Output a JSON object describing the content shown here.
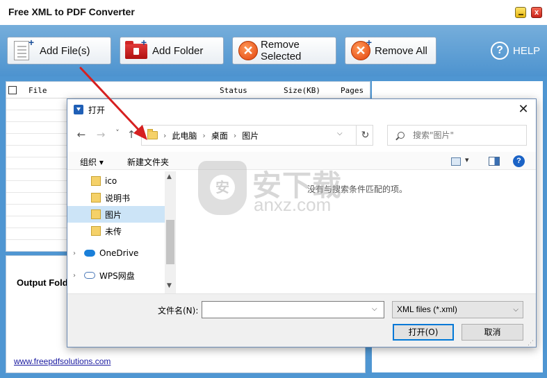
{
  "app": {
    "title": "Free XML to PDF Converter",
    "close_glyph": "x"
  },
  "toolbar": {
    "add_files": "Add File(s)",
    "add_folder": "Add Folder",
    "remove_selected": "Remove Selected",
    "remove_all": "Remove All",
    "help": "HELP",
    "help_glyph": "?",
    "plus_glyph": "+",
    "x_glyph": "✕"
  },
  "file_list": {
    "columns": [
      "File",
      "Status",
      "Size(KB)",
      "Pages"
    ]
  },
  "output": {
    "label": "Output Fold",
    "website": "www.freepdfsolutions.com"
  },
  "watermark": {
    "cn": "安下载",
    "en": "anxz.com"
  },
  "dialog": {
    "title": "打开",
    "close_glyph": "✕",
    "nav": {
      "back": "←",
      "forward": "→",
      "recent": "˅",
      "up": "↑"
    },
    "breadcrumb": [
      "此电脑",
      "桌面",
      "图片"
    ],
    "breadcrumb_sep": "›",
    "address_dropdown": "⌵",
    "refresh_glyph": "↻",
    "search_placeholder": "搜索\"图片\"",
    "organize": "组织 ▾",
    "new_folder": "新建文件夹",
    "help_glyph": "?",
    "nav_items": [
      {
        "label": "ico",
        "kind": "folder"
      },
      {
        "label": "说明书",
        "kind": "folder"
      },
      {
        "label": "图片",
        "kind": "folder",
        "selected": true
      },
      {
        "label": "未传",
        "kind": "folder"
      },
      {
        "label": "OneDrive",
        "kind": "cloud"
      },
      {
        "label": "WPS网盘",
        "kind": "cloud"
      }
    ],
    "chevron": "›",
    "scroll_up": "▲",
    "scroll_down": "▼",
    "empty_message": "没有与搜索条件匹配的项。",
    "filename_label": "文件名(N):",
    "filename_value": "",
    "filetype": "XML files (*.xml)",
    "dropdown_glyph": "⌵",
    "open": "打开(O)",
    "cancel": "取消",
    "grip": "⋰"
  },
  "colors": {
    "toolbar_blue": "#4d93cf",
    "annotation_red": "#d62020",
    "dialog_accent": "#0078d7"
  }
}
